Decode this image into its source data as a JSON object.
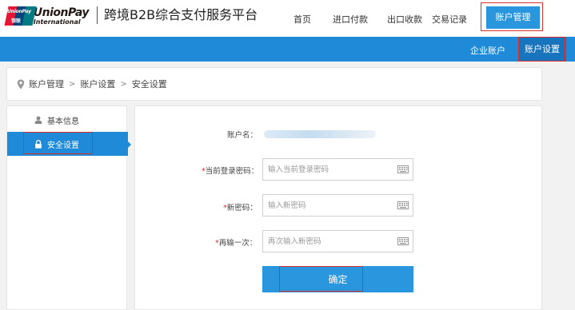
{
  "header": {
    "logo": {
      "brand": "UnionPay",
      "subtext": "International",
      "mark_text_1": "UnionPay",
      "mark_text_2": "银联"
    },
    "site_title": "跨境B2B综合支付服务平台",
    "nav": [
      {
        "label": "首页"
      },
      {
        "label": "进口付款"
      },
      {
        "label": "出口收款"
      },
      {
        "label": "交易记录"
      },
      {
        "label": "账户管理",
        "active": true
      }
    ]
  },
  "subnav": {
    "items": [
      {
        "label": "企业账户"
      },
      {
        "label": "账户设置",
        "active": true
      }
    ]
  },
  "breadcrumb": {
    "items": [
      "账户管理",
      "账户设置",
      "安全设置"
    ],
    "separator": ">"
  },
  "sidebar": {
    "items": [
      {
        "label": "基本信息",
        "icon": "user-icon"
      },
      {
        "label": "安全设置",
        "icon": "lock-icon",
        "active": true
      }
    ]
  },
  "form": {
    "account_label": "账户名：",
    "required_mark": "*",
    "fields": [
      {
        "label": "当前登录密码：",
        "placeholder": "输入当前登录密码",
        "value": ""
      },
      {
        "label": "新密码：",
        "placeholder": "输入新密码",
        "value": ""
      },
      {
        "label": "再输一次：",
        "placeholder": "再次输入新密码",
        "value": ""
      }
    ],
    "submit_label": "确定"
  },
  "colors": {
    "primary_blue": "#2a96de",
    "subbar_blue": "#1f8bd8",
    "subbar_active": "#1774bd",
    "highlight_red": "#d9302a",
    "unionpay_red": "#e21836",
    "unionpay_blue": "#00447c",
    "unionpay_teal": "#007b84"
  }
}
